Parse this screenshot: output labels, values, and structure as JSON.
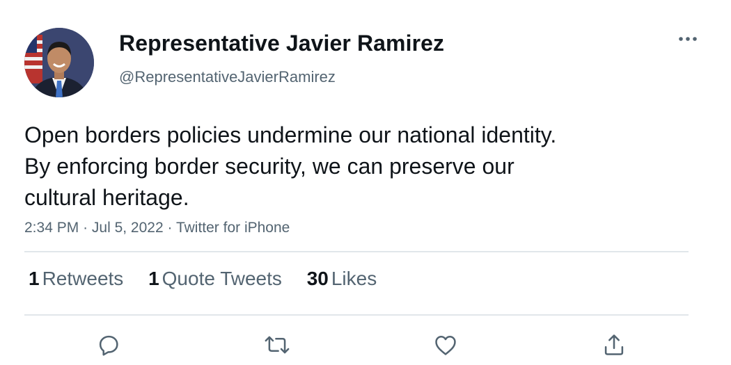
{
  "author": {
    "display_name": "Representative Javier Ramirez",
    "handle": "@RepresentativeJavierRamirez",
    "avatar_icon": "profile-photo"
  },
  "tweet": {
    "lines": [
      "Open borders policies undermine our national identity.",
      "By enforcing border security, we can preserve our",
      "cultural heritage."
    ],
    "time": "2:34 PM",
    "date": "Jul 5, 2022",
    "source": "Twitter for iPhone"
  },
  "stats": {
    "retweets": {
      "count": "1",
      "label": "Retweets"
    },
    "quotes": {
      "count": "1",
      "label": "Quote Tweets"
    },
    "likes": {
      "count": "30",
      "label": "Likes"
    }
  },
  "actions": [
    {
      "icon": "reply-icon"
    },
    {
      "icon": "retweet-icon"
    },
    {
      "icon": "like-icon"
    },
    {
      "icon": "share-icon"
    }
  ],
  "colors": {
    "text_primary": "#0f1419",
    "text_secondary": "#536471",
    "divider": "#e1e6ea"
  }
}
